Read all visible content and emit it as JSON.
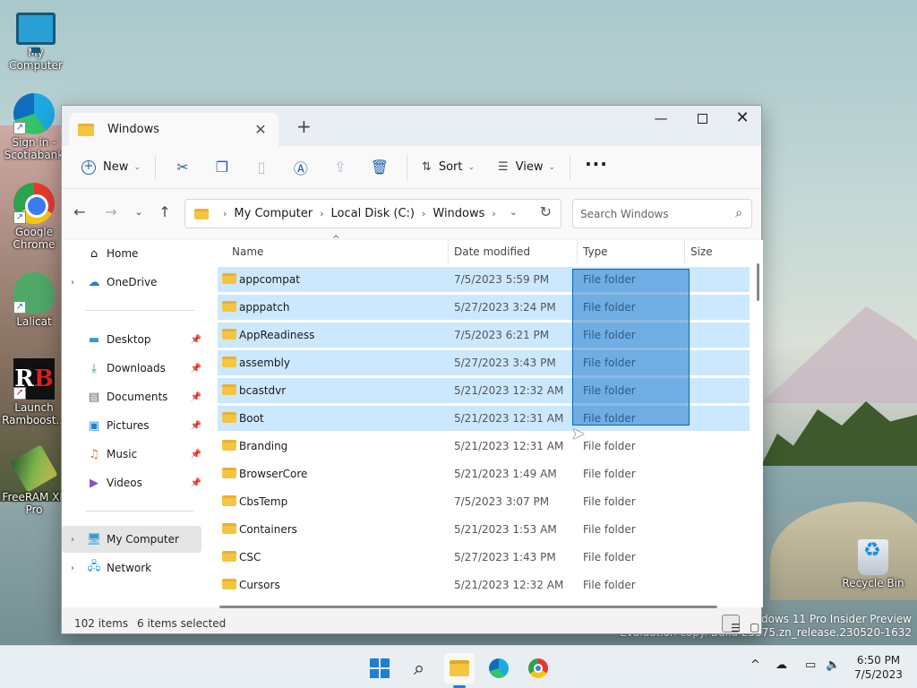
{
  "desktop": {
    "icons": [
      {
        "label": "My Computer"
      },
      {
        "label": "Sign in - Scotiabank"
      },
      {
        "label": "Google Chrome"
      },
      {
        "label": "Lalicat"
      },
      {
        "label": "Launch Ramboost..."
      },
      {
        "label": "FreeRAM XP Pro"
      },
      {
        "label": "Recycle Bin"
      }
    ],
    "watermark": {
      "line1": "Windows 11 Pro Insider Preview",
      "line2": "Evaluation copy. Build 25375.zn_release.230520-1632"
    }
  },
  "window": {
    "tab_title": "Windows",
    "tab_close": "✕",
    "new_tab": "+",
    "controls": {
      "minimize": "—",
      "close": "✕"
    }
  },
  "toolbar": {
    "new_label": "New",
    "sort_label": "Sort",
    "view_label": "View",
    "more_label": "···"
  },
  "address": {
    "crumbs": [
      "My Computer",
      "Local Disk (C:)",
      "Windows"
    ],
    "search_placeholder": "Search Windows"
  },
  "nav": {
    "items": [
      {
        "label": "Home"
      },
      {
        "label": "OneDrive"
      },
      {
        "label": "Desktop"
      },
      {
        "label": "Downloads"
      },
      {
        "label": "Documents"
      },
      {
        "label": "Pictures"
      },
      {
        "label": "Music"
      },
      {
        "label": "Videos"
      },
      {
        "label": "My Computer"
      },
      {
        "label": "Network"
      }
    ]
  },
  "columns": {
    "name": "Name",
    "date": "Date modified",
    "type": "Type",
    "size": "Size"
  },
  "files": [
    {
      "name": "appcompat",
      "date": "7/5/2023 5:59 PM",
      "type": "File folder"
    },
    {
      "name": "apppatch",
      "date": "5/27/2023 3:24 PM",
      "type": "File folder"
    },
    {
      "name": "AppReadiness",
      "date": "7/5/2023 6:21 PM",
      "type": "File folder"
    },
    {
      "name": "assembly",
      "date": "5/27/2023 3:43 PM",
      "type": "File folder"
    },
    {
      "name": "bcastdvr",
      "date": "5/21/2023 12:32 AM",
      "type": "File folder"
    },
    {
      "name": "Boot",
      "date": "5/21/2023 12:31 AM",
      "type": "File folder"
    },
    {
      "name": "Branding",
      "date": "5/21/2023 12:31 AM",
      "type": "File folder"
    },
    {
      "name": "BrowserCore",
      "date": "5/21/2023 1:49 AM",
      "type": "File folder"
    },
    {
      "name": "CbsTemp",
      "date": "7/5/2023 3:07 PM",
      "type": "File folder"
    },
    {
      "name": "Containers",
      "date": "5/21/2023 1:53 AM",
      "type": "File folder"
    },
    {
      "name": "CSC",
      "date": "5/27/2023 1:43 PM",
      "type": "File folder"
    },
    {
      "name": "Cursors",
      "date": "5/21/2023 12:32 AM",
      "type": "File folder"
    }
  ],
  "status": {
    "count": "102 items",
    "selected": "6 items selected"
  },
  "taskbar": {
    "time": "6:50 PM",
    "date": "7/5/2023"
  }
}
